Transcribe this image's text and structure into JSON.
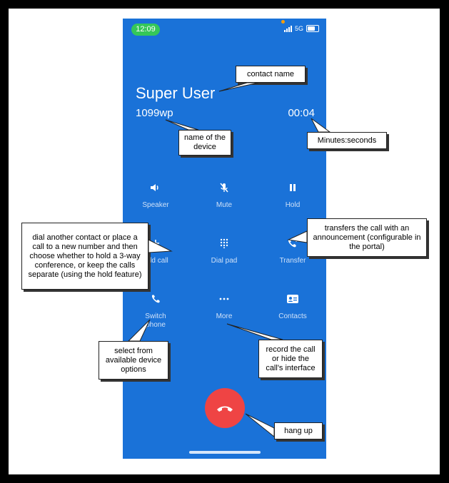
{
  "status_bar": {
    "time": "12:09",
    "network": "5G"
  },
  "call": {
    "contact_name": "Super User",
    "device_name": "1099wp",
    "timer": "00:04"
  },
  "controls": [
    {
      "label": "Speaker",
      "icon": "speaker-icon"
    },
    {
      "label": "Mute",
      "icon": "mute-mic-icon"
    },
    {
      "label": "Hold",
      "icon": "pause-icon"
    },
    {
      "label": "Add call",
      "icon": "plus-icon"
    },
    {
      "label": "Dial pad",
      "icon": "dialpad-icon"
    },
    {
      "label": "Transfer",
      "icon": "transfer-icon"
    },
    {
      "label": "Switch phone",
      "icon": "phone-icon"
    },
    {
      "label": "More",
      "icon": "more-dots-icon"
    },
    {
      "label": "Contacts",
      "icon": "contacts-card-icon"
    }
  ],
  "callouts": {
    "contact_name": "contact name",
    "device_name": "name of the device",
    "timer": "Minutes:seconds",
    "add_call": "dial another contact or place a call to a new number and then choose whether to hold a 3-way conference, or keep the calls separate (using the hold feature)",
    "transfer": "transfers the call with an announcement (configurable in the portal)",
    "switch_phone": "select from available device options",
    "more": "record the call or hide the call's interface",
    "hang_up": "hang up"
  },
  "colors": {
    "screen_bg": "#1a72d8",
    "time_pill": "#35c759",
    "hangup": "#ef4444"
  }
}
